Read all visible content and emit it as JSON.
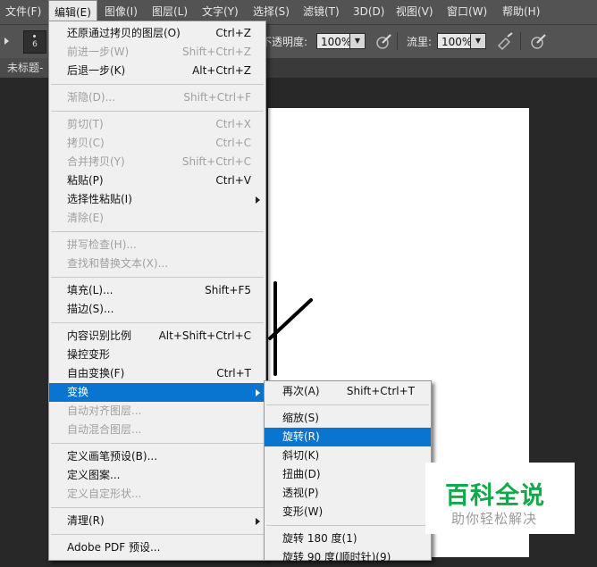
{
  "menubar": {
    "items": [
      "文件(F)",
      "编辑(E)",
      "图像(I)",
      "图层(L)",
      "文字(Y)",
      "选择(S)",
      "滤镜(T)",
      "3D(D)",
      "视图(V)",
      "窗口(W)",
      "帮助(H)"
    ],
    "active_index": 1
  },
  "options_bar": {
    "brush_size": "6",
    "opacity_label": "不透明度:",
    "opacity_value": "100%",
    "flow_label": "流里:",
    "flow_value": "100%"
  },
  "document": {
    "tab_title": "未标题-"
  },
  "edit_menu": {
    "items": [
      {
        "label": "还原通过拷贝的图层(O)",
        "shortcut": "Ctrl+Z",
        "enabled": true
      },
      {
        "label": "前进一步(W)",
        "shortcut": "Shift+Ctrl+Z",
        "enabled": false
      },
      {
        "label": "后退一步(K)",
        "shortcut": "Alt+Ctrl+Z",
        "enabled": true
      },
      {
        "label": "渐隐(D)...",
        "shortcut": "Shift+Ctrl+F",
        "enabled": false
      },
      {
        "label": "剪切(T)",
        "shortcut": "Ctrl+X",
        "enabled": false
      },
      {
        "label": "拷贝(C)",
        "shortcut": "Ctrl+C",
        "enabled": false
      },
      {
        "label": "合并拷贝(Y)",
        "shortcut": "Shift+Ctrl+C",
        "enabled": false
      },
      {
        "label": "粘贴(P)",
        "shortcut": "Ctrl+V",
        "enabled": true
      },
      {
        "label": "选择性粘贴(I)",
        "shortcut": "",
        "enabled": true,
        "submenu": true
      },
      {
        "label": "清除(E)",
        "shortcut": "",
        "enabled": false
      },
      {
        "label": "拼写检查(H)...",
        "shortcut": "",
        "enabled": false
      },
      {
        "label": "查找和替换文本(X)...",
        "shortcut": "",
        "enabled": false
      },
      {
        "label": "填充(L)...",
        "shortcut": "Shift+F5",
        "enabled": true
      },
      {
        "label": "描边(S)...",
        "shortcut": "",
        "enabled": true
      },
      {
        "label": "内容识别比例",
        "shortcut": "Alt+Shift+Ctrl+C",
        "enabled": true
      },
      {
        "label": "操控变形",
        "shortcut": "",
        "enabled": true
      },
      {
        "label": "自由变换(F)",
        "shortcut": "Ctrl+T",
        "enabled": true
      },
      {
        "label": "变换",
        "shortcut": "",
        "enabled": true,
        "submenu": true,
        "highlighted": true
      },
      {
        "label": "自动对齐图层...",
        "shortcut": "",
        "enabled": false
      },
      {
        "label": "自动混合图层...",
        "shortcut": "",
        "enabled": false
      },
      {
        "label": "定义画笔预设(B)...",
        "shortcut": "",
        "enabled": true
      },
      {
        "label": "定义图案...",
        "shortcut": "",
        "enabled": true
      },
      {
        "label": "定义自定形状...",
        "shortcut": "",
        "enabled": false
      },
      {
        "label": "清理(R)",
        "shortcut": "",
        "enabled": true,
        "submenu": true
      },
      {
        "label": "Adobe PDF 预设...",
        "shortcut": "",
        "enabled": true
      }
    ]
  },
  "transform_submenu": {
    "items": [
      {
        "label": "再次(A)",
        "shortcut": "Shift+Ctrl+T"
      },
      {
        "label": "缩放(S)",
        "shortcut": ""
      },
      {
        "label": "旋转(R)",
        "shortcut": "",
        "highlighted": true
      },
      {
        "label": "斜切(K)",
        "shortcut": ""
      },
      {
        "label": "扭曲(D)",
        "shortcut": ""
      },
      {
        "label": "透视(P)",
        "shortcut": ""
      },
      {
        "label": "变形(W)",
        "shortcut": ""
      },
      {
        "label": "旋转 180 度(1)",
        "shortcut": ""
      },
      {
        "label": "旋转 90 度(顺时针)(9)",
        "shortcut": ""
      }
    ]
  },
  "watermark": {
    "main": "百科全说",
    "sub": "助你轻松解决"
  },
  "colors": {
    "menu_highlight": "#0a74d1",
    "watermark_green": "#13a84a"
  }
}
